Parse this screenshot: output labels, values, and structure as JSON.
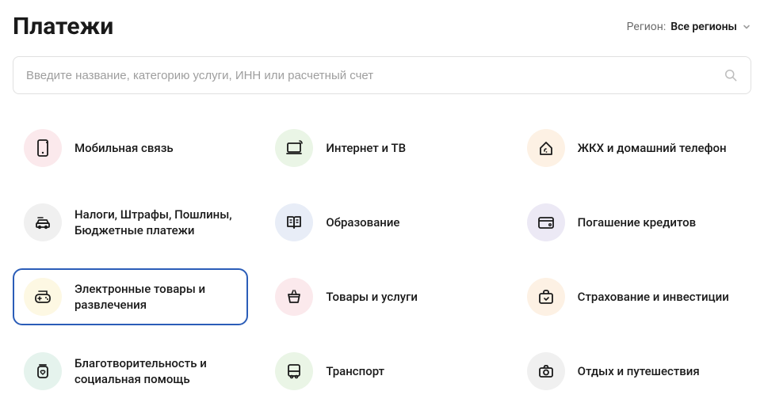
{
  "header": {
    "title": "Платежи",
    "region_label": "Регион:",
    "region_value": "Все регионы"
  },
  "search": {
    "placeholder": "Введите название, категорию услуги, ИНН или расчетный счет"
  },
  "categories": [
    {
      "id": "mobile",
      "label": "Мобильная связь",
      "icon": "smartphone-icon",
      "bg": "bg-pink",
      "selected": false
    },
    {
      "id": "internet-tv",
      "label": "Интернет и ТВ",
      "icon": "laptop-wifi-icon",
      "bg": "bg-green",
      "selected": false
    },
    {
      "id": "utilities",
      "label": "ЖКХ и домашний телефон",
      "icon": "home-phone-icon",
      "bg": "bg-orange",
      "selected": false
    },
    {
      "id": "taxes",
      "label": "Налоги, Штрафы, Пошлины, Бюджетные платежи",
      "icon": "tax-car-icon",
      "bg": "bg-gray",
      "selected": false
    },
    {
      "id": "education",
      "label": "Образование",
      "icon": "book-open-icon",
      "bg": "bg-blue",
      "selected": false
    },
    {
      "id": "loans",
      "label": "Погашение кредитов",
      "icon": "credit-card-icon",
      "bg": "bg-violet",
      "selected": false
    },
    {
      "id": "electronics",
      "label": "Электронные товары и развлечения",
      "icon": "gamepad-icon",
      "bg": "bg-yellow",
      "selected": true
    },
    {
      "id": "goods",
      "label": "Товары и услуги",
      "icon": "basket-icon",
      "bg": "bg-pink",
      "selected": false
    },
    {
      "id": "insurance",
      "label": "Страхование и инвестиции",
      "icon": "briefcase-icon",
      "bg": "bg-orange",
      "selected": false
    },
    {
      "id": "charity",
      "label": "Благотворительность и социальная помощь",
      "icon": "jar-heart-icon",
      "bg": "bg-mint",
      "selected": false
    },
    {
      "id": "transport",
      "label": "Транспорт",
      "icon": "bus-icon",
      "bg": "bg-green",
      "selected": false
    },
    {
      "id": "leisure",
      "label": "Отдых и путешествия",
      "icon": "camera-icon",
      "bg": "bg-gray",
      "selected": false
    }
  ]
}
